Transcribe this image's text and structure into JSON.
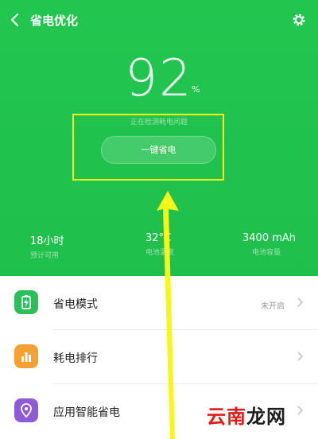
{
  "header": {
    "title": "省电优化",
    "back_icon": "chevron-left-icon",
    "settings_icon": "gear-icon"
  },
  "battery": {
    "percent": "92",
    "unit": "%",
    "scan_text": "正在检测耗电问题"
  },
  "action_button": {
    "label": "一键省电"
  },
  "stats": [
    {
      "value": "18小时",
      "label": "预计可用"
    },
    {
      "value": "32°C",
      "label": "电池温度"
    },
    {
      "value": "3400 mAh",
      "label": "电池容量"
    }
  ],
  "menu": [
    {
      "label": "省电模式",
      "status": "未开启",
      "icon": "battery-mode-icon",
      "color": "#2bbf5a"
    },
    {
      "label": "耗电排行",
      "status": "",
      "icon": "bar-chart-icon",
      "color": "#f5a032"
    },
    {
      "label": "应用智能省电",
      "status": "",
      "icon": "location-pin-icon",
      "color": "#8e5bd6"
    }
  ],
  "watermark": {
    "part1": "云南",
    "part2": "龙网"
  },
  "colors": {
    "hero": "#22c64f",
    "highlight": "#f7f61a"
  }
}
